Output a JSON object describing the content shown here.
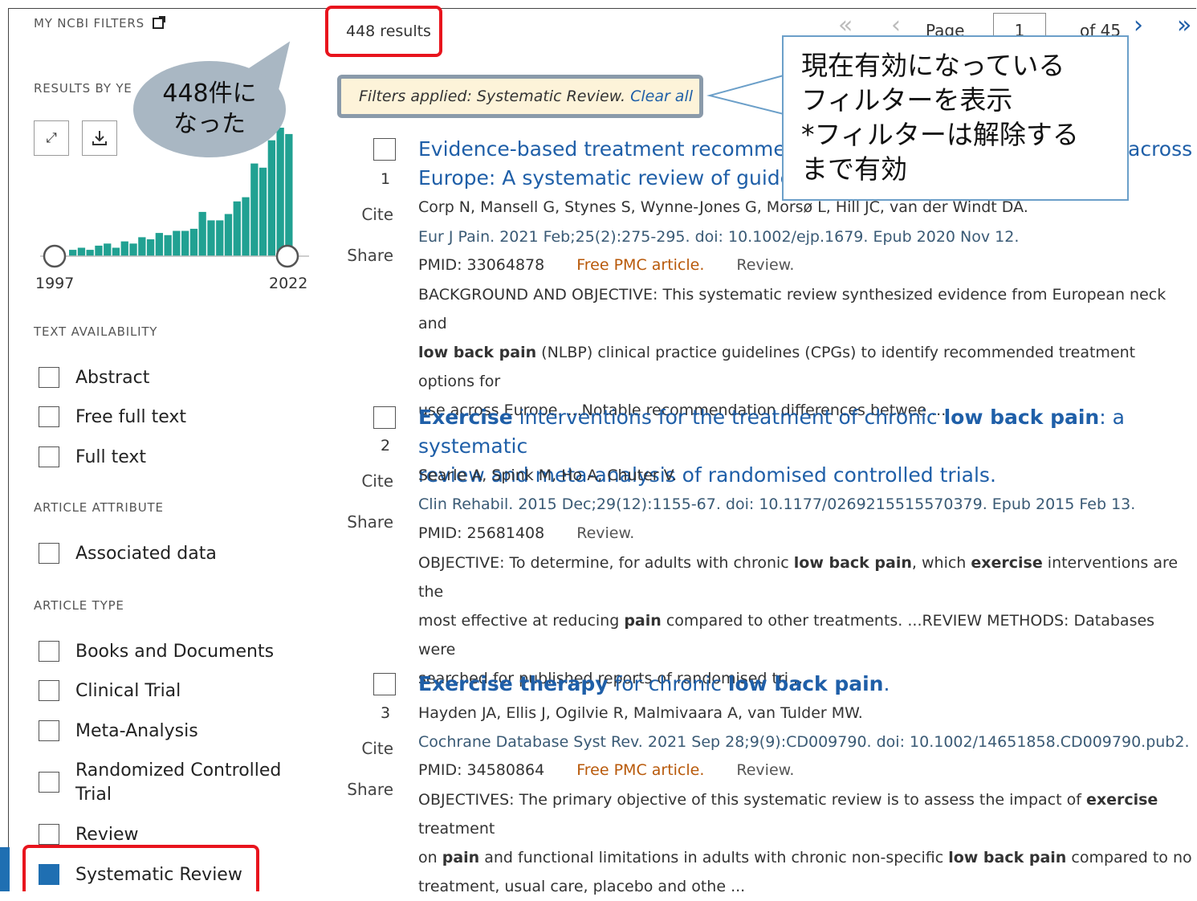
{
  "sidebar": {
    "my_filters_label": "MY NCBI FILTERS",
    "results_by_year_label": "RESULTS BY YE",
    "year_start": "1997",
    "year_end": "2022",
    "histogram_values": [
      3,
      4,
      3,
      5,
      6,
      4,
      7,
      6,
      9,
      8,
      11,
      10,
      12,
      12,
      13,
      21,
      17,
      17,
      20,
      26,
      28,
      44,
      42,
      55,
      61,
      58
    ],
    "histogram_max": 61,
    "histogram_color": "#21a192",
    "text_availability_label": "TEXT AVAILABILITY",
    "text_availability": [
      "Abstract",
      "Free full text",
      "Full text"
    ],
    "article_attribute_label": "ARTICLE ATTRIBUTE",
    "article_attribute": [
      "Associated data"
    ],
    "article_type_label": "ARTICLE TYPE",
    "article_type": [
      "Books and Documents",
      "Clinical Trial",
      "Meta-Analysis",
      "Randomized Controlled Trial",
      "Review",
      "Systematic Review"
    ]
  },
  "header": {
    "results_count": "448 results",
    "page_label": "Page",
    "page_value": "1",
    "page_of": "of 45"
  },
  "filters": {
    "applied_text": "Filters applied: Systematic Review.",
    "clear_all": "Clear all"
  },
  "results": [
    {
      "num": "1",
      "cite": "Cite",
      "share": "Share",
      "title_html": "Evidence-based treatment recommend",
      "title_tail": "across",
      "title_line2": "Europe: A systematic review of guideli",
      "authors": "Corp N, Mansell G, Stynes S, Wynne-Jones G, Morsø L, Hill JC, van der Windt DA.",
      "journal": "Eur J Pain. 2021 Feb;25(2):275-295. doi: 10.1002/ejp.1679. Epub 2020 Nov 12.",
      "pmid": "PMID: 33064878",
      "free_pmc": "Free PMC article.",
      "review": "Review.",
      "snippet_1": "BACKGROUND AND OBJECTIVE: This systematic review synthesized evidence from European neck and",
      "snippet_2_bold": "low back pain",
      "snippet_2": " (NLBP) clinical practice guidelines (CPGs) to identify recommended treatment options for",
      "snippet_3": "use across Europe. ...Notable recommendation differences betwee ..."
    },
    {
      "num": "2",
      "cite": "Cite",
      "share": "Share",
      "title_b1": "Exercise",
      "title_t1": " interventions for the treatment of chronic ",
      "title_b2": "low back pain",
      "title_t2": ": a systematic",
      "title_line2": "review and meta-analysis of randomised controlled trials.",
      "authors": "Searle A, Spink M, Ho A, Chuter V.",
      "journal": "Clin Rehabil. 2015 Dec;29(12):1155-67. doi: 10.1177/0269215515570379. Epub 2015 Feb 13.",
      "pmid": "PMID: 25681408",
      "review": "Review.",
      "s1_a": "OBJECTIVE: To determine, for adults with chronic ",
      "s1_b": "low back pain",
      "s1_c": ", which ",
      "s1_d": "exercise",
      "s1_e": " interventions are the",
      "s2_a": "most effective at reducing ",
      "s2_b": "pain",
      "s2_c": " compared to other treatments. ...REVIEW METHODS: Databases were",
      "s3": "searched for published reports of randomised tri ..."
    },
    {
      "num": "3",
      "cite": "Cite",
      "share": "Share",
      "title_b1": "Exercise therapy",
      "title_t1": " for chronic ",
      "title_b2": "low back pain",
      "title_t2": ".",
      "authors": "Hayden JA, Ellis J, Ogilvie R, Malmivaara A, van Tulder MW.",
      "journal": "Cochrane Database Syst Rev. 2021 Sep 28;9(9):CD009790. doi: 10.1002/14651858.CD009790.pub2.",
      "pmid": "PMID: 34580864",
      "free_pmc": "Free PMC article.",
      "review": "Review.",
      "s1_a": "OBJECTIVES: The primary objective of this systematic review is to assess the impact of ",
      "s1_b": "exercise",
      "s1_c": " treatment",
      "s2_a": "on ",
      "s2_b": "pain",
      "s2_c": " and functional limitations in adults with chronic non-specific ",
      "s2_d": "low back pain",
      "s2_e": " compared to no",
      "s3": "treatment, usual care, placebo and othe ..."
    }
  ],
  "annotations": {
    "bubble_text_1": "448件に",
    "bubble_text_2": "なった",
    "box_line_1": "現在有効になっている",
    "box_line_2": "フィルターを表示",
    "box_line_3": "*フィルターは解除する",
    "box_line_4": "まで有効",
    "highlight_color": "#e8141d"
  }
}
